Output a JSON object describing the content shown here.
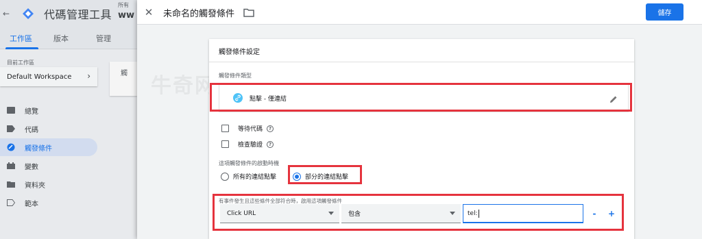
{
  "app": {
    "title": "代碼管理工具",
    "account_label": "所有",
    "account_name": "ww",
    "tabs": [
      {
        "label": "工作區"
      },
      {
        "label": "版本"
      },
      {
        "label": "管理"
      }
    ],
    "workspace_label": "目前工作區",
    "workspace_name": "Default Workspace",
    "nav": [
      {
        "label": "總覽",
        "icon": "overview-icon"
      },
      {
        "label": "代碼",
        "icon": "tag-icon"
      },
      {
        "label": "觸發條件",
        "icon": "trigger-icon"
      },
      {
        "label": "變數",
        "icon": "variable-icon"
      },
      {
        "label": "資料夾",
        "icon": "folder-icon"
      },
      {
        "label": "範本",
        "icon": "template-icon"
      }
    ],
    "bg_card_text": "觸"
  },
  "panel": {
    "title": "未命名的觸發條件",
    "save_label": "儲存"
  },
  "card": {
    "title": "觸發條件設定",
    "type_label": "觸發條件類型",
    "type_value": "點擊 - 僅連結",
    "checkboxes": [
      {
        "label": "等待代碼",
        "checked": false
      },
      {
        "label": "檢查驗證",
        "checked": false
      }
    ],
    "fire_label": "這項觸發條件的啟動時機",
    "radios": [
      {
        "label": "所有的連結點擊",
        "checked": false
      },
      {
        "label": "部分的連結點擊",
        "checked": true
      }
    ],
    "condition_label": "有事件發生且這些條件全部符合時，啟用這項觸發條件",
    "condition": {
      "variable": "Click URL",
      "operator": "包含",
      "value": "tel:"
    },
    "minus_label": "-",
    "plus_label": "+"
  },
  "watermark": "牛奇网",
  "colors": {
    "accent": "#1a73e8",
    "highlight": "#e5333d",
    "link_icon": "#4fc3f7"
  }
}
